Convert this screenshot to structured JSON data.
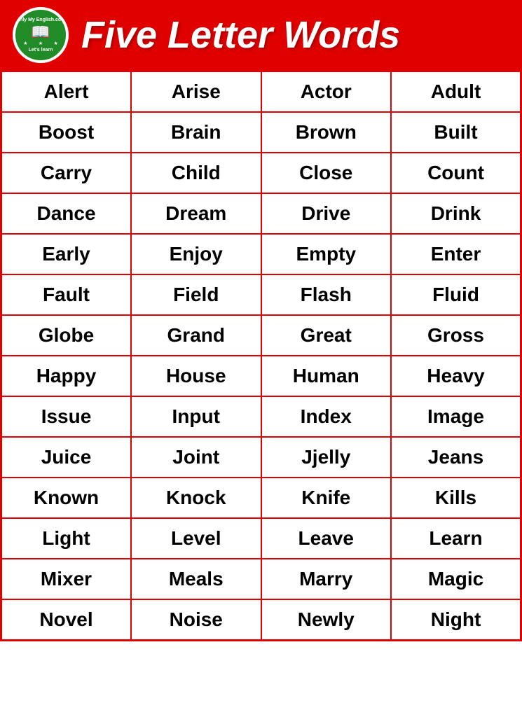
{
  "header": {
    "title": "Five Letter Words",
    "logo": {
      "top_text": "Only My English.com",
      "bottom_text": "Let's learn"
    }
  },
  "table": {
    "rows": [
      [
        "Alert",
        "Arise",
        "Actor",
        "Adult"
      ],
      [
        "Boost",
        "Brain",
        "Brown",
        "Built"
      ],
      [
        "Carry",
        "Child",
        "Close",
        "Count"
      ],
      [
        "Dance",
        "Dream",
        "Drive",
        "Drink"
      ],
      [
        "Early",
        "Enjoy",
        "Empty",
        "Enter"
      ],
      [
        "Fault",
        "Field",
        "Flash",
        "Fluid"
      ],
      [
        "Globe",
        "Grand",
        "Great",
        "Gross"
      ],
      [
        "Happy",
        "House",
        "Human",
        "Heavy"
      ],
      [
        "Issue",
        "Input",
        "Index",
        "Image"
      ],
      [
        "Juice",
        "Joint",
        "Jjelly",
        "Jeans"
      ],
      [
        "Known",
        "Knock",
        "Knife",
        "Kills"
      ],
      [
        "Light",
        "Level",
        "Leave",
        "Learn"
      ],
      [
        "Mixer",
        "Meals",
        "Marry",
        "Magic"
      ],
      [
        "Novel",
        "Noise",
        "Newly",
        "Night"
      ]
    ]
  }
}
